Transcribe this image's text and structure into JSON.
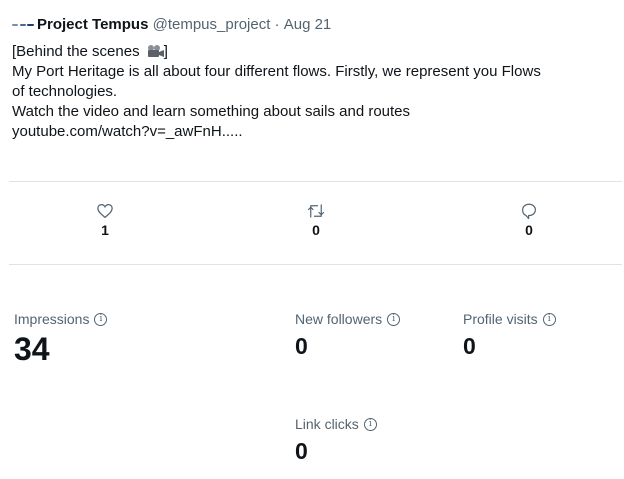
{
  "tweet": {
    "author_name": "Project Tempus",
    "author_handle": "@tempus_project",
    "separator": "·",
    "date": "Aug 21",
    "lines": [
      "[Behind the scenes",
      "]",
      "My Port Heritage is all about four different flows. Firstly, we represent you Flows",
      "of technologies.",
      "Watch the video and learn something about sails and routes"
    ],
    "link": "youtube.com/watch?v=_awFnH....."
  },
  "actions": {
    "like": {
      "icon": "heart-icon",
      "count": "1"
    },
    "retweet": {
      "icon": "retweet-icon",
      "count": "0"
    },
    "reply": {
      "icon": "reply-icon",
      "count": "0"
    }
  },
  "metrics": {
    "impressions": {
      "label": "Impressions",
      "value": "34"
    },
    "new_followers": {
      "label": "New followers",
      "value": "0"
    },
    "profile_visits": {
      "label": "Profile visits",
      "value": "0"
    },
    "link_clicks": {
      "label": "Link clicks",
      "value": "0"
    },
    "info_icon": "info-icon"
  }
}
